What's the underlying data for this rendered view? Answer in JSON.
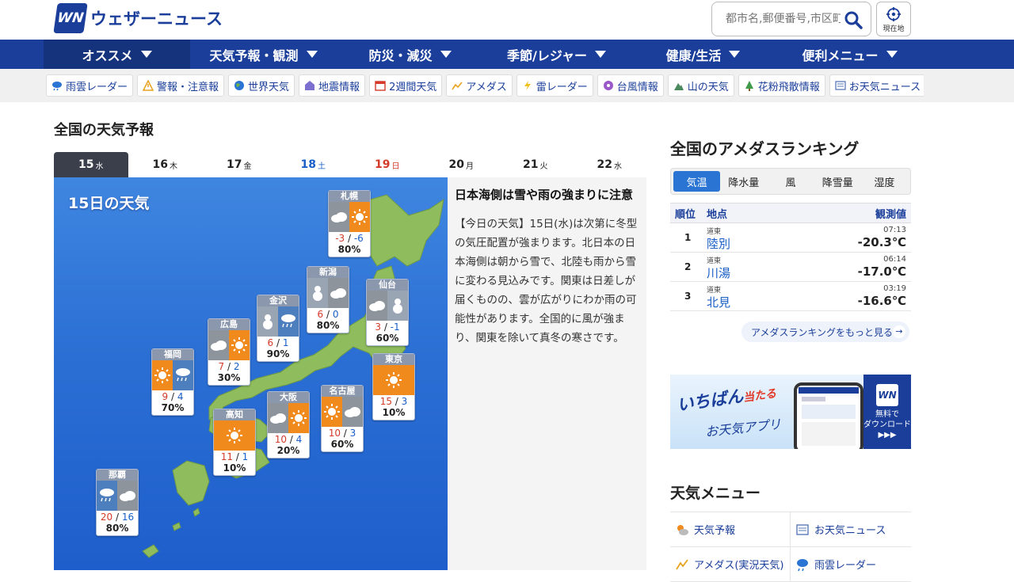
{
  "header": {
    "logo_mark": "WN",
    "logo_text": "ウェザーニュース",
    "search_placeholder": "都市名,郵便番号,市区町村",
    "current_location_label": "現在地"
  },
  "global_nav": [
    {
      "label": "オススメ"
    },
    {
      "label": "天気予報・観測"
    },
    {
      "label": "防災・減災"
    },
    {
      "label": "季節/レジャー"
    },
    {
      "label": "健康/生活"
    },
    {
      "label": "便利メニュー"
    }
  ],
  "sub_nav": [
    {
      "label": "雨雲レーダー",
      "icon": "rain-cloud-icon"
    },
    {
      "label": "警報・注意報",
      "icon": "warning-icon"
    },
    {
      "label": "世界天気",
      "icon": "globe-icon"
    },
    {
      "label": "地震情報",
      "icon": "earthquake-icon"
    },
    {
      "label": "2週間天気",
      "icon": "calendar-icon"
    },
    {
      "label": "アメダス",
      "icon": "amedas-icon"
    },
    {
      "label": "雷レーダー",
      "icon": "lightning-icon"
    },
    {
      "label": "台風情報",
      "icon": "typhoon-icon"
    },
    {
      "label": "山の天気",
      "icon": "mountain-icon"
    },
    {
      "label": "花粉飛散情報",
      "icon": "pollen-icon"
    },
    {
      "label": "お天気ニュース",
      "icon": "news-icon"
    }
  ],
  "forecast": {
    "section_title": "全国の天気予報",
    "map_title": "15日の天気",
    "days": [
      {
        "date": "15",
        "dow": "水",
        "type": "weekday"
      },
      {
        "date": "16",
        "dow": "木",
        "type": "weekday"
      },
      {
        "date": "17",
        "dow": "金",
        "type": "weekday"
      },
      {
        "date": "18",
        "dow": "土",
        "type": "sat"
      },
      {
        "date": "19",
        "dow": "日",
        "type": "sun"
      },
      {
        "date": "20",
        "dow": "月",
        "type": "weekday"
      },
      {
        "date": "21",
        "dow": "火",
        "type": "weekday"
      },
      {
        "date": "22",
        "dow": "水",
        "type": "weekday"
      }
    ],
    "cities": [
      {
        "name": "札幌",
        "hi": "-3",
        "lo": "-6",
        "pop": "80%",
        "icons": [
          "cloud-icon",
          "sun-icon"
        ]
      },
      {
        "name": "新潟",
        "hi": "6",
        "lo": "0",
        "pop": "80%",
        "icons": [
          "snow-icon",
          "cloud-icon"
        ]
      },
      {
        "name": "仙台",
        "hi": "3",
        "lo": "-1",
        "pop": "60%",
        "icons": [
          "cloud-icon",
          "snow-icon"
        ]
      },
      {
        "name": "金沢",
        "hi": "6",
        "lo": "1",
        "pop": "90%",
        "icons": [
          "snow-icon",
          "rain-icon"
        ]
      },
      {
        "name": "広島",
        "hi": "7",
        "lo": "2",
        "pop": "30%",
        "icons": [
          "cloud-icon",
          "sun-icon"
        ]
      },
      {
        "name": "東京",
        "hi": "15",
        "lo": "3",
        "pop": "10%",
        "icons": [
          "sun-icon"
        ]
      },
      {
        "name": "福岡",
        "hi": "9",
        "lo": "4",
        "pop": "70%",
        "icons": [
          "sun-icon",
          "rain-icon"
        ]
      },
      {
        "name": "名古屋",
        "hi": "10",
        "lo": "3",
        "pop": "60%",
        "icons": [
          "sun-icon",
          "cloud-icon"
        ]
      },
      {
        "name": "大阪",
        "hi": "10",
        "lo": "4",
        "pop": "20%",
        "icons": [
          "cloud-icon",
          "sun-icon"
        ]
      },
      {
        "name": "高知",
        "hi": "11",
        "lo": "1",
        "pop": "10%",
        "icons": [
          "sun-icon"
        ]
      },
      {
        "name": "那覇",
        "hi": "20",
        "lo": "16",
        "pop": "80%",
        "icons": [
          "rain-icon",
          "cloud-icon"
        ]
      }
    ],
    "article_title": "日本海側は雪や雨の強まりに注意",
    "article_body": "【今日の天気】15日(水)は次第に冬型の気圧配置が強まります。北日本の日本海側は朝から雪で、北陸も雨から雪に変わる見込みです。関東は日差しが届くものの、雲が広がりにわか雨の可能性があります。全国的に風が強まり、関東を除いて真冬の寒さです。"
  },
  "ranking": {
    "title": "全国のアメダスランキング",
    "tabs": [
      "気温",
      "降水量",
      "風",
      "降雪量",
      "湿度"
    ],
    "headers": {
      "rank": "順位",
      "place": "地点",
      "value": "観測値"
    },
    "rows": [
      {
        "rank": "1",
        "pref": "道東",
        "place": "陸別",
        "time": "07:13",
        "value": "-20.3℃"
      },
      {
        "rank": "2",
        "pref": "道東",
        "place": "川湯",
        "time": "06:14",
        "value": "-17.0℃"
      },
      {
        "rank": "3",
        "pref": "道東",
        "place": "北見",
        "time": "03:19",
        "value": "-16.6℃"
      }
    ],
    "more_label": "アメダスランキングをもっと見る"
  },
  "banner": {
    "main": "いちばん",
    "main_em": "当たる",
    "sub": "お天気アプリ",
    "side_logo": "WN",
    "side_text_1": "無料で",
    "side_text_2": "ダウンロード",
    "side_arrows": "▶▶▶"
  },
  "weather_menu": {
    "title": "天気メニュー",
    "items": [
      {
        "label": "天気予報",
        "icon": "sun-cloud-icon"
      },
      {
        "label": "お天気ニュース",
        "icon": "news-icon"
      },
      {
        "label": "アメダス(実況天気)",
        "icon": "amedas-icon"
      },
      {
        "label": "雨雲レーダー",
        "icon": "rain-cloud-icon"
      }
    ]
  },
  "colors": {
    "brand_blue": "#1a3e9a",
    "sea_blue": "#2b6fd4",
    "land_green": "#8fbc5c",
    "high_temp_red": "#d43a2a",
    "low_temp_blue": "#1a5fc7",
    "sun_orange": "#f08a1c"
  }
}
